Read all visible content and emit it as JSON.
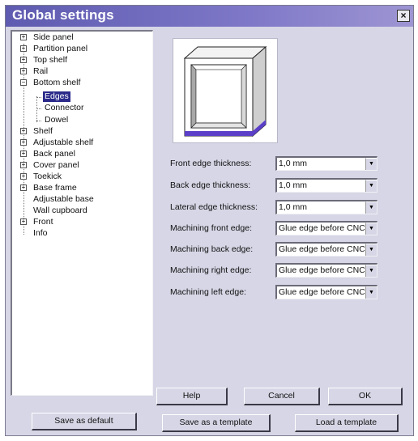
{
  "window": {
    "title": "Global settings",
    "close_glyph": "×"
  },
  "tree": {
    "items": [
      {
        "label": "Side panel",
        "expander": "+"
      },
      {
        "label": "Partition panel",
        "expander": "+"
      },
      {
        "label": "Top shelf",
        "expander": "+"
      },
      {
        "label": "Rail",
        "expander": "+"
      },
      {
        "label": "Bottom shelf",
        "expander": "−"
      },
      {
        "label": "Edges",
        "selected": true
      },
      {
        "label": "Connector"
      },
      {
        "label": "Dowel"
      },
      {
        "label": "Shelf",
        "expander": "+"
      },
      {
        "label": "Adjustable shelf",
        "expander": "+"
      },
      {
        "label": "Back panel",
        "expander": "+"
      },
      {
        "label": "Cover panel",
        "expander": "+"
      },
      {
        "label": "Toekick",
        "expander": "+"
      },
      {
        "label": "Base frame",
        "expander": "+"
      },
      {
        "label": "Adjustable base"
      },
      {
        "label": "Wall cupboard"
      },
      {
        "label": "Front",
        "expander": "+"
      },
      {
        "label": "Info"
      }
    ]
  },
  "preview": {
    "icon": "cabinet-edge-preview-icon",
    "highlight_color": "#5b3fc8"
  },
  "form": {
    "fields": [
      {
        "label": "Front edge thickness:",
        "value": "1,0 mm"
      },
      {
        "label": "Back edge thickness:",
        "value": "1,0 mm"
      },
      {
        "label": "Lateral edge thickness:",
        "value": "1,0 mm"
      },
      {
        "label": "Machining front edge:",
        "value": "Glue edge before CNC +"
      },
      {
        "label": "Machining back edge:",
        "value": "Glue edge before CNC +"
      },
      {
        "label": "Machining right edge:",
        "value": "Glue edge before CNC +"
      },
      {
        "label": "Machining left edge:",
        "value": "Glue edge before CNC +"
      }
    ]
  },
  "buttons": {
    "help": "Help",
    "cancel": "Cancel",
    "ok": "OK",
    "save_default": "Save as default",
    "save_template": "Save as a template",
    "load_template": "Load a template"
  },
  "colors": {
    "titlebar": "#6e69be",
    "selection": "#2b2a8a",
    "dialog_bg": "#d6d6e6"
  }
}
